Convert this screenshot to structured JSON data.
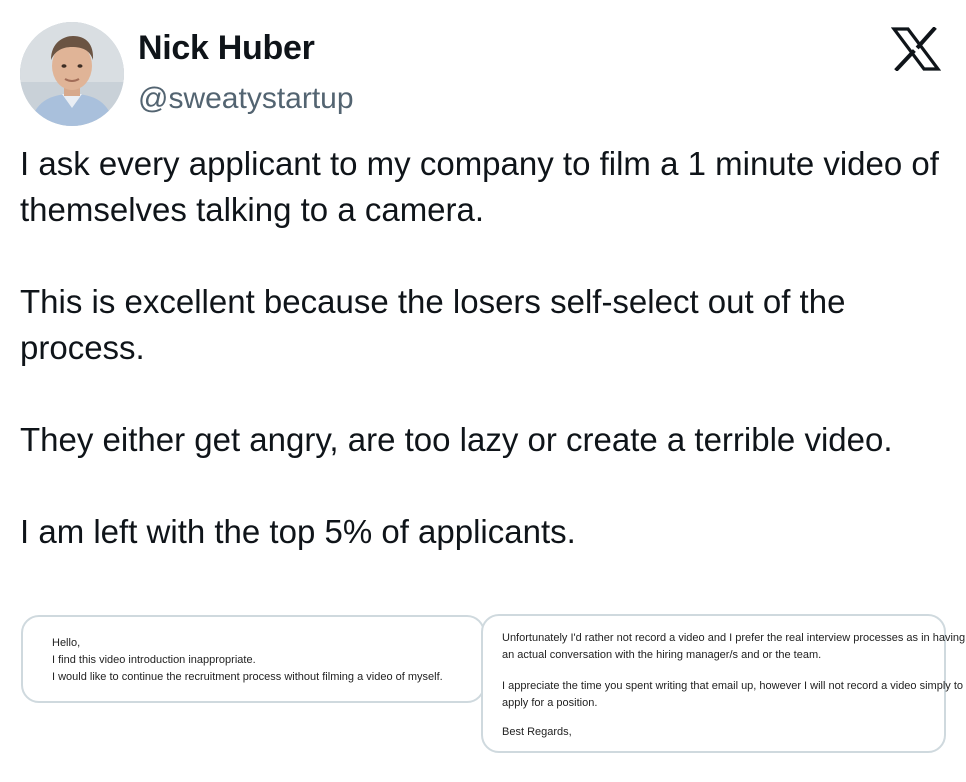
{
  "author": {
    "display_name": "Nick Huber",
    "handle": "@sweatystartup",
    "avatar_icon": "person-portrait"
  },
  "brand": {
    "logo_icon": "x-logo",
    "color": "#0f1419"
  },
  "tweet": {
    "paragraphs": [
      "I ask every applicant to my company to film a 1 minute video of themselves talking to a camera.",
      "This is excellent because the losers self-select out of the process.",
      "They either get angry, are too lazy or create a terrible video.",
      "I am left with the top 5% of applicants."
    ]
  },
  "media": {
    "left_email": {
      "lines": [
        "Hello,",
        "I find this video introduction inappropriate.",
        "I would like to continue the recruitment process without filming a video of myself."
      ]
    },
    "right_email": {
      "lines": [
        "Unfortunately I'd rather not record a video and I prefer the real interview processes as in having",
        "an actual conversation with the hiring manager/s and or the team.",
        "I appreciate the time you spent writing that email up, however I will not record a video simply to",
        "apply for a position.",
        "Best Regards,"
      ]
    }
  }
}
